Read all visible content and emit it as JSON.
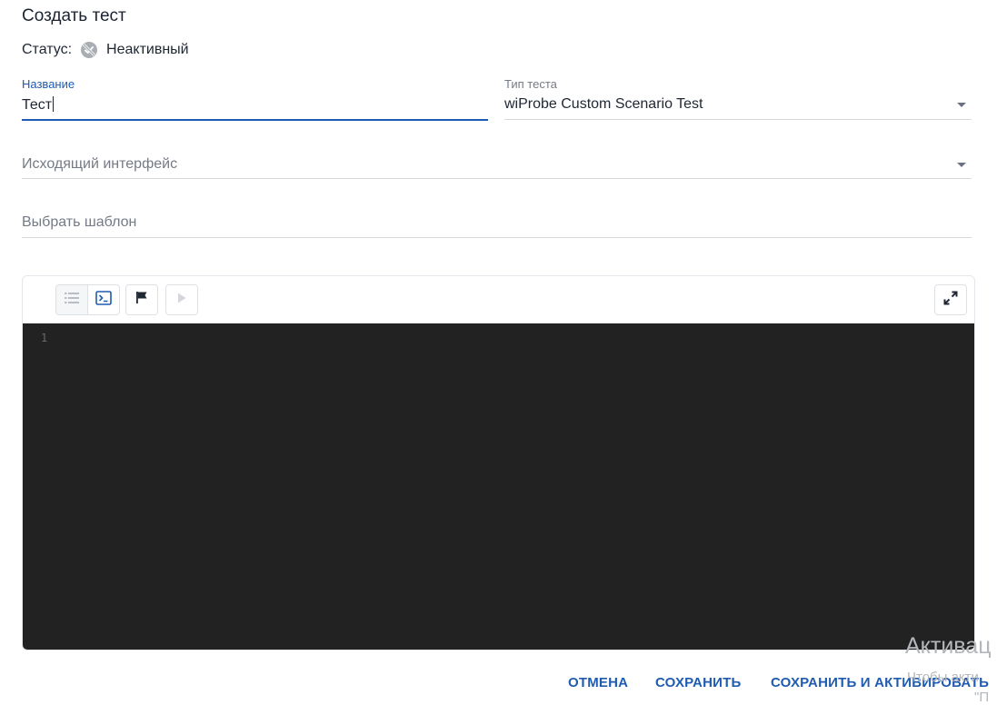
{
  "page": {
    "title": "Создать тест"
  },
  "status": {
    "label": "Статус:",
    "value": "Неактивный",
    "icon": "status-inactive-icon"
  },
  "form": {
    "name": {
      "label": "Название",
      "value": "Тест"
    },
    "test_type": {
      "label": "Тип теста",
      "value": "wiProbe Custom Scenario Test"
    },
    "outgoing_interface": {
      "placeholder": "Исходящий интерфейс"
    },
    "template": {
      "placeholder": "Выбрать шаблон"
    }
  },
  "editor": {
    "toolbar": {
      "list_icon": "list-icon",
      "terminal_icon": "terminal-icon",
      "flag_icon": "flag-icon",
      "play_icon": "play-icon",
      "fullscreen_icon": "fullscreen-icon"
    },
    "line_numbers": [
      "1"
    ]
  },
  "actions": {
    "cancel": "ОТМЕНА",
    "save": "СОХРАНИТЬ",
    "save_activate": "СОХРАНИТЬ И АКТИВИРОВАТЬ"
  },
  "watermark": {
    "line1": "Активац",
    "line2": "Чтобы акти",
    "line3": "\"П"
  },
  "colors": {
    "accent": "#1f5bb0",
    "editor_bg": "#222222",
    "label_gray": "#757b86"
  }
}
